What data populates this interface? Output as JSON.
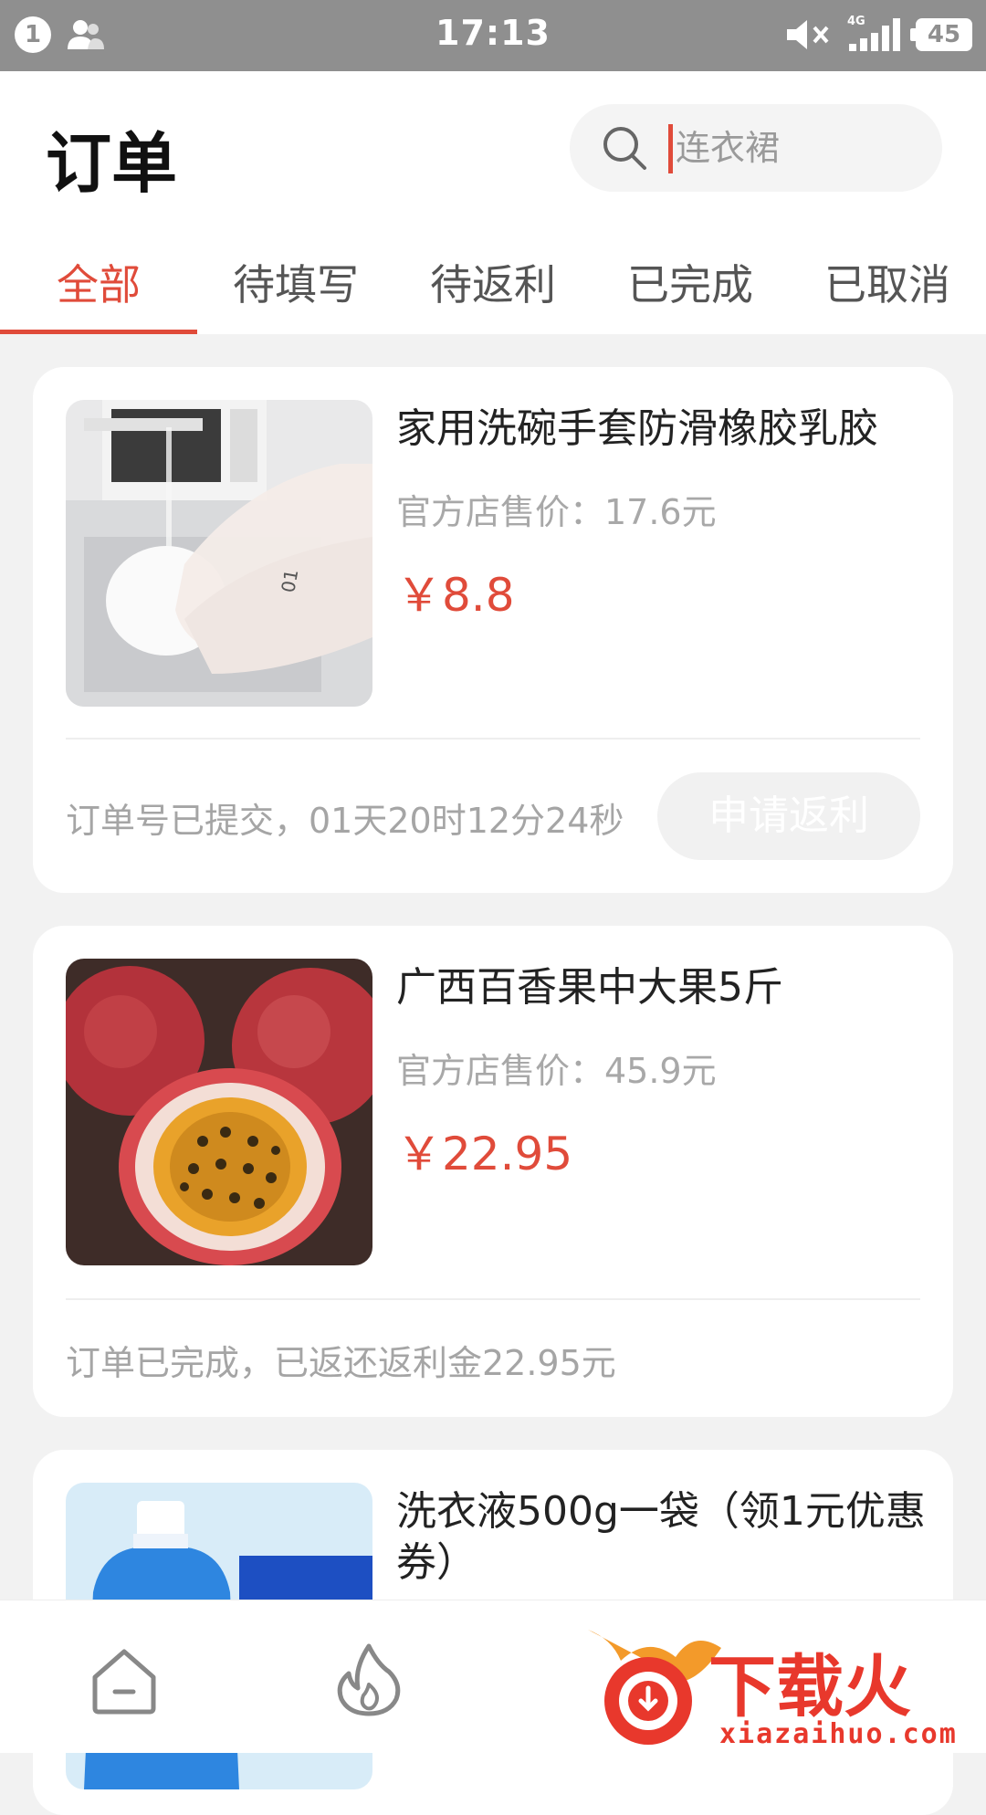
{
  "status_bar": {
    "notification_count": "1",
    "time": "17:13",
    "network": "4G",
    "battery": "45",
    "icons": [
      "user-icon",
      "mute-icon",
      "signal-icon",
      "battery-icon"
    ]
  },
  "header": {
    "title": "订单",
    "search_placeholder": "连衣裙"
  },
  "tabs": [
    {
      "label": "全部",
      "active": true
    },
    {
      "label": "待填写",
      "active": false
    },
    {
      "label": "待返利",
      "active": false
    },
    {
      "label": "已完成",
      "active": false
    },
    {
      "label": "已取消",
      "active": false
    }
  ],
  "orders": [
    {
      "title": "家用洗碗手套防滑橡胶乳胶",
      "orig_price": "官方店售价：17.6元",
      "price": "￥8.8",
      "status": "订单号已提交，01天20时12分24秒",
      "button": "申请返利",
      "image": "dish-gloves-photo"
    },
    {
      "title": "广西百香果中大果5斤",
      "orig_price": "官方店售价：45.9元",
      "price": "￥22.95",
      "status": "订单已完成，已返还返利金22.95元",
      "image": "passion-fruit-photo"
    },
    {
      "title": "洗衣液500g一袋（领1元优惠券）",
      "image": "laundry-detergent-photo"
    }
  ],
  "bottom_nav": {
    "items": [
      "home-icon",
      "fire-icon"
    ],
    "watermark_text": "下载火",
    "watermark_url": "xiazaihuo.com"
  },
  "colors": {
    "accent": "#e04b3a",
    "status_bar": "#8f8f8f",
    "background": "#f2f2f2"
  }
}
